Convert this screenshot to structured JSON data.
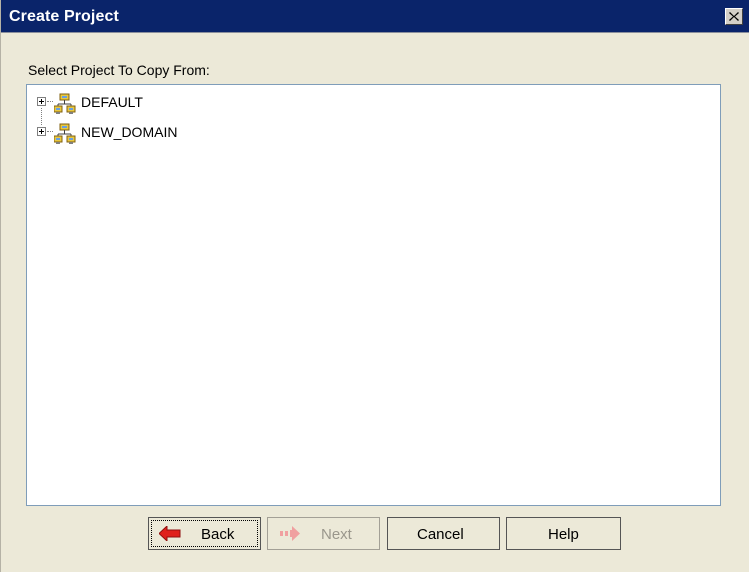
{
  "window": {
    "title": "Create Project"
  },
  "dialog": {
    "prompt": "Select Project To Copy From:"
  },
  "tree": {
    "nodes": [
      {
        "label": "DEFAULT",
        "icon": "network-domain-icon"
      },
      {
        "label": "NEW_DOMAIN",
        "icon": "network-domain-icon"
      }
    ]
  },
  "buttons": {
    "back": "Back",
    "next": "Next",
    "cancel": "Cancel",
    "help": "Help"
  },
  "colors": {
    "titlebar": "#0a246a",
    "dialog_bg": "#ece9d8",
    "back_arrow": "#e0201c",
    "next_arrow_disabled": "#f0a0a0"
  }
}
